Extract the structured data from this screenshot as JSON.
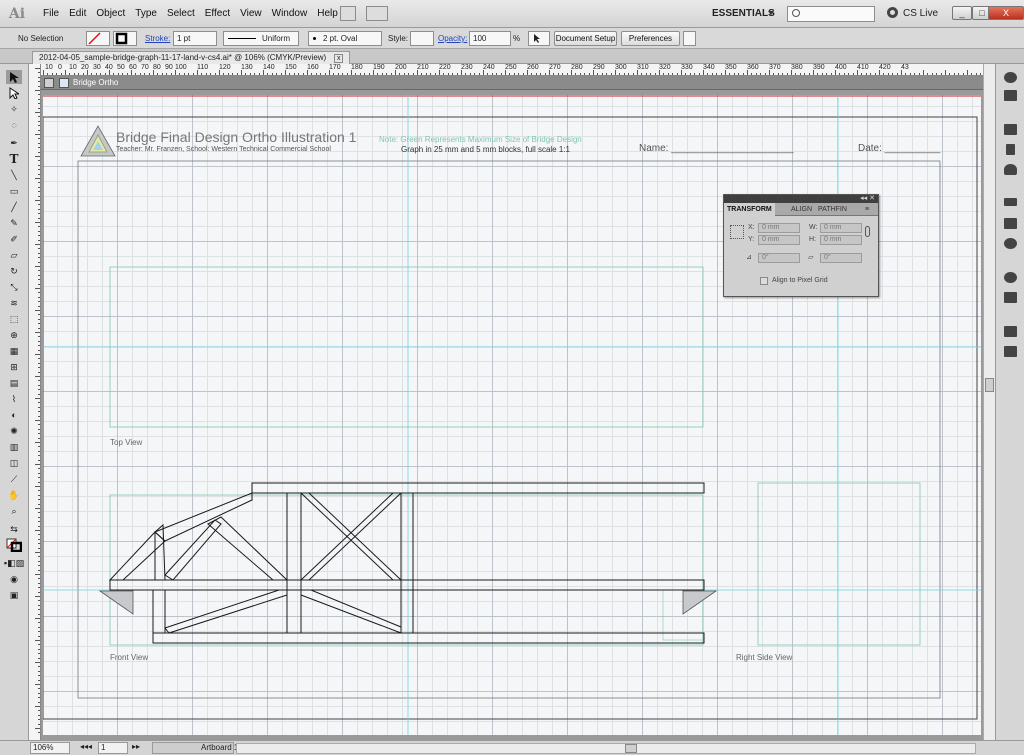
{
  "app": {
    "logo_text": "Ai"
  },
  "menubar": {
    "items": [
      "File",
      "Edit",
      "Object",
      "Type",
      "Select",
      "Effect",
      "View",
      "Window",
      "Help"
    ],
    "workspace": "ESSENTIALS",
    "search_placeholder": "",
    "cs_live": "CS Live",
    "window_buttons": [
      "_",
      "□",
      "X"
    ]
  },
  "control_bar": {
    "selection": "No Selection",
    "stroke_label": "Stroke:",
    "stroke_weight": "1 pt",
    "stroke_profile": "Uniform",
    "brush": "2 pt. Oval",
    "style_label": "Style:",
    "opacity_label": "Opacity:",
    "opacity_value": "100",
    "opacity_unit": "%",
    "document_setup": "Document Setup",
    "preferences": "Preferences"
  },
  "document_tab": {
    "title": "2012-04-05_sample-bridge-graph-11-17-land-v-cs4.ai* @ 106% (CMYK/Preview)",
    "close": "x"
  },
  "breadcrumb": {
    "layer": "Bridge Ortho"
  },
  "ruler": {
    "labels": [
      "10",
      "0",
      "10",
      "20",
      "30",
      "40",
      "50",
      "60",
      "70",
      "80",
      "90",
      "100",
      "110",
      "120",
      "130",
      "140",
      "150",
      "160",
      "170",
      "180",
      "190",
      "200",
      "210",
      "220",
      "230",
      "240",
      "250",
      "260",
      "270",
      "280",
      "290",
      "300",
      "310",
      "320",
      "330",
      "340",
      "350",
      "360",
      "370",
      "380",
      "390",
      "400",
      "410",
      "420",
      "43"
    ]
  },
  "artboard": {
    "title": "Bridge Final Design Ortho Illustration 1",
    "teacher_line": "Teacher: Mr. Franzen,  School: Western Technical Commercial School",
    "note": "Note: Green Represents Maximum Size of Bridge Design",
    "graph_note": "Graph in 25 mm and 5 mm blocks, full scale 1:1",
    "name_label": "Name: ______________________",
    "date_label": "Date: __________",
    "top_view": "Top View",
    "front_view": "Front View",
    "right_side_view": "Right Side View"
  },
  "transform_panel": {
    "tabs": [
      "TRANSFORM",
      "ALIGN",
      "PATHFIN"
    ],
    "x_label": "X:",
    "x_value": "0 mm",
    "y_label": "Y:",
    "y_value": "0 mm",
    "w_label": "W:",
    "w_value": "0 mm",
    "h_label": "H:",
    "h_value": "0 mm",
    "rotate_value": "0°",
    "shear_value": "0°",
    "align_pixel_grid": "Align to Pixel Grid"
  },
  "status_bar": {
    "zoom": "106%",
    "artboard_number": "1",
    "artboard_label": "Artboard 1"
  },
  "colors": {
    "accent_red": "#c8202a",
    "guide_cyan": "#6fd3e0",
    "max_size_green": "#7fc7b0"
  }
}
